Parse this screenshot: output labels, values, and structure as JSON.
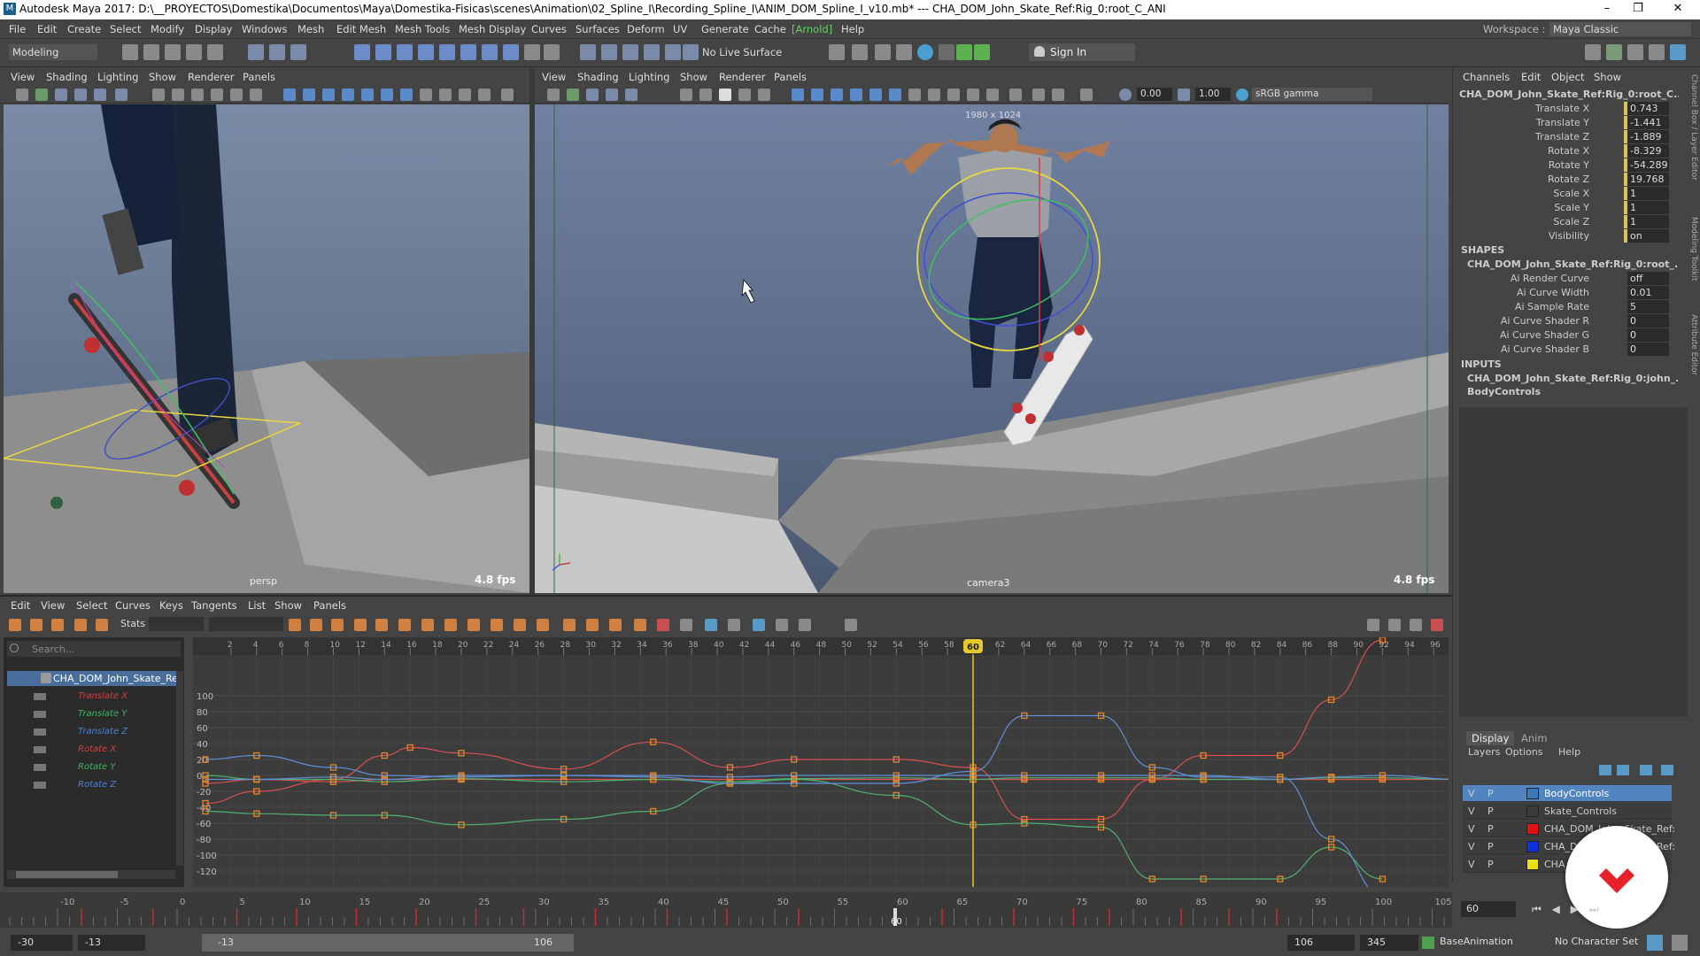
{
  "title_bar": {
    "logo": "M",
    "title": "Autodesk Maya 2017: D:\\__PROYECTOS\\Domestika\\Documentos\\Maya\\Domestika-Fisicas\\scenes\\Animation\\02_Spline_I\\Recording_Spline_I\\ANIM_DOM_Spline_I_v10.mb*   ---   CHA_DOM_John_Skate_Ref:Rig_0:root_C_ANI",
    "minimize": "–",
    "maximize": "❐",
    "close": "✕"
  },
  "menu": {
    "items": [
      "File",
      "Edit",
      "Create",
      "Select",
      "Modify",
      "Display",
      "Windows",
      "Mesh",
      "Edit Mesh",
      "Mesh Tools",
      "Mesh Display",
      "Curves",
      "Surfaces",
      "Deform",
      "UV",
      "Generate",
      "Cache",
      "[Arnold]",
      "Help"
    ],
    "workspace_label": "Workspace :",
    "workspace_value": "Maya Classic"
  },
  "toolbar": {
    "mode": "Modeling",
    "live_surface": "No Live Surface",
    "sign_in": "Sign In"
  },
  "viewport_left": {
    "menus": [
      "View",
      "Shading",
      "Lighting",
      "Show",
      "Renderer",
      "Panels"
    ],
    "camera": "persp",
    "fps": "4.8 fps"
  },
  "viewport_right": {
    "menus": [
      "View",
      "Shading",
      "Lighting",
      "Show",
      "Renderer",
      "Panels"
    ],
    "resolution": "1980 x 1024",
    "camera": "camera3",
    "fps": "4.8 fps",
    "exposure": "0.00",
    "gamma": "1.00",
    "color_space": "sRGB gamma"
  },
  "channel_box": {
    "tabs": [
      "Channels",
      "Edit",
      "Object",
      "Show"
    ],
    "object": "CHA_DOM_John_Skate_Ref:Rig_0:root_C...",
    "channels": [
      {
        "label": "Translate X",
        "value": "0.743"
      },
      {
        "label": "Translate Y",
        "value": "-1.441"
      },
      {
        "label": "Translate Z",
        "value": "-1.889"
      },
      {
        "label": "Rotate X",
        "value": "-8.329"
      },
      {
        "label": "Rotate Y",
        "value": "-54.289"
      },
      {
        "label": "Rotate Z",
        "value": "19.768"
      },
      {
        "label": "Scale X",
        "value": "1"
      },
      {
        "label": "Scale Y",
        "value": "1"
      },
      {
        "label": "Scale Z",
        "value": "1"
      },
      {
        "label": "Visibility",
        "value": "on"
      }
    ],
    "shapes_header": "SHAPES",
    "shape_name": "CHA_DOM_John_Skate_Ref:Rig_0:root_...",
    "shape_attrs": [
      {
        "label": "Ai Render Curve",
        "value": "off"
      },
      {
        "label": "Ai Curve Width",
        "value": "0.01"
      },
      {
        "label": "Ai Sample Rate",
        "value": "5"
      },
      {
        "label": "Ai Curve Shader R",
        "value": "0"
      },
      {
        "label": "Ai Curve Shader G",
        "value": "0"
      },
      {
        "label": "Ai Curve Shader B",
        "value": "0"
      }
    ],
    "inputs_header": "INPUTS",
    "inputs": [
      "CHA_DOM_John_Skate_Ref:Rig_0:john_...",
      "BodyControls"
    ],
    "side_tabs": [
      "Channel Box / Layer Editor",
      "Modeling Toolkit",
      "Attribute Editor"
    ]
  },
  "layer_editor": {
    "tabs": [
      "Display",
      "Anim"
    ],
    "menus": [
      "Layers",
      "Options",
      "Help"
    ],
    "layers": [
      {
        "v": "V",
        "p": "P",
        "name": "BodyControls",
        "color": "#3a78b8",
        "selected": true
      },
      {
        "v": "V",
        "p": "P",
        "name": "Skate_Controls",
        "color": "",
        "selected": false
      },
      {
        "v": "V",
        "p": "P",
        "name": "CHA_DOM_John_Skate_Ref:",
        "color": "#e01010",
        "selected": false
      },
      {
        "v": "V",
        "p": "P",
        "name": "CHA_DOM_John_Skate_Ref:",
        "color": "#1030e0",
        "selected": false
      },
      {
        "v": "V",
        "p": "P",
        "name": "CHA_D",
        "color": "#e8e010",
        "selected": false
      }
    ]
  },
  "graph_editor": {
    "menus": [
      "Edit",
      "View",
      "Select",
      "Curves",
      "Keys",
      "Tangents",
      "List",
      "Show",
      "Panels"
    ],
    "stats_label": "Stats",
    "search_placeholder": "Search...",
    "outliner_node": "CHA_DOM_John_Skate_Ref",
    "outliner_curves": [
      {
        "label": "Translate X",
        "color": "#d04040"
      },
      {
        "label": "Translate Y",
        "color": "#40b060"
      },
      {
        "label": "Translate Z",
        "color": "#5080d0"
      },
      {
        "label": "Rotate X",
        "color": "#d04040"
      },
      {
        "label": "Rotate Y",
        "color": "#40b060"
      },
      {
        "label": "Rotate Z",
        "color": "#5080d0"
      }
    ],
    "current_frame": "60",
    "frame_ticks": [
      "2",
      "4",
      "6",
      "8",
      "10",
      "12",
      "14",
      "16",
      "18",
      "20",
      "22",
      "24",
      "26",
      "28",
      "30",
      "32",
      "34",
      "36",
      "38",
      "40",
      "42",
      "44",
      "46",
      "48",
      "50",
      "52",
      "54",
      "56",
      "58",
      "60",
      "62",
      "64",
      "66",
      "68",
      "70",
      "72",
      "74",
      "76",
      "78",
      "80",
      "82",
      "84",
      "86",
      "88",
      "90",
      "92",
      "94",
      "96",
      "98"
    ],
    "value_ticks": [
      "100",
      "80",
      "60",
      "40",
      "20",
      "0",
      "-20",
      "-40",
      "-60",
      "-80",
      "-100",
      "-120"
    ]
  },
  "chart_data": {
    "type": "line",
    "title": "",
    "xlabel": "",
    "ylabel": "",
    "xlim": [
      0,
      98
    ],
    "ylim": [
      -130,
      115
    ],
    "series": [
      {
        "color": "#d85050",
        "points": [
          [
            0,
            -35
          ],
          [
            4,
            -20
          ],
          [
            10,
            -5
          ],
          [
            14,
            25
          ],
          [
            16,
            35
          ],
          [
            20,
            28
          ],
          [
            28,
            8
          ],
          [
            35,
            42
          ],
          [
            41,
            10
          ],
          [
            46,
            20
          ],
          [
            54,
            20
          ],
          [
            60,
            10
          ],
          [
            64,
            -55
          ],
          [
            70,
            -55
          ],
          [
            74,
            -5
          ],
          [
            78,
            25
          ],
          [
            84,
            25
          ],
          [
            88,
            95
          ],
          [
            92,
            170
          ]
        ]
      },
      {
        "color": "#d85050",
        "points": [
          [
            0,
            -10
          ],
          [
            4,
            -5
          ],
          [
            10,
            -8
          ],
          [
            14,
            -5
          ],
          [
            20,
            -5
          ],
          [
            28,
            -5
          ],
          [
            35,
            -5
          ],
          [
            41,
            -5
          ],
          [
            46,
            -5
          ],
          [
            54,
            -5
          ],
          [
            60,
            -5
          ],
          [
            64,
            -5
          ],
          [
            70,
            -5
          ],
          [
            74,
            -5
          ],
          [
            78,
            -5
          ],
          [
            84,
            -5
          ],
          [
            88,
            -5
          ],
          [
            92,
            -5
          ],
          [
            98,
            -5
          ]
        ]
      },
      {
        "color": "#50b070",
        "points": [
          [
            0,
            -45
          ],
          [
            4,
            -48
          ],
          [
            10,
            -50
          ],
          [
            14,
            -50
          ],
          [
            20,
            -62
          ],
          [
            28,
            -55
          ],
          [
            35,
            -45
          ],
          [
            41,
            -10
          ],
          [
            46,
            -5
          ],
          [
            54,
            -25
          ],
          [
            60,
            -62
          ],
          [
            64,
            -60
          ],
          [
            70,
            -65
          ],
          [
            74,
            -130
          ],
          [
            78,
            -130
          ],
          [
            84,
            -130
          ],
          [
            88,
            -90
          ],
          [
            92,
            -130
          ]
        ]
      },
      {
        "color": "#50b070",
        "points": [
          [
            0,
            0
          ],
          [
            4,
            -5
          ],
          [
            10,
            -5
          ],
          [
            14,
            -8
          ],
          [
            20,
            -4
          ],
          [
            28,
            -8
          ],
          [
            35,
            -5
          ],
          [
            41,
            -8
          ],
          [
            46,
            -4
          ],
          [
            54,
            -3
          ],
          [
            60,
            -5
          ],
          [
            64,
            -3
          ],
          [
            70,
            -3
          ],
          [
            74,
            -3
          ],
          [
            78,
            -5
          ],
          [
            84,
            -5
          ],
          [
            88,
            -3
          ],
          [
            92,
            -3
          ],
          [
            98,
            -5
          ]
        ]
      },
      {
        "color": "#6090d8",
        "points": [
          [
            0,
            20
          ],
          [
            4,
            25
          ],
          [
            10,
            10
          ],
          [
            14,
            0
          ],
          [
            20,
            -2
          ],
          [
            28,
            0
          ],
          [
            35,
            -2
          ],
          [
            41,
            -10
          ],
          [
            46,
            -10
          ],
          [
            54,
            -10
          ],
          [
            60,
            5
          ],
          [
            64,
            75
          ],
          [
            70,
            75
          ],
          [
            74,
            10
          ],
          [
            78,
            -2
          ],
          [
            84,
            -2
          ],
          [
            88,
            -80
          ],
          [
            92,
            -150
          ]
        ]
      },
      {
        "color": "#6090d8",
        "points": [
          [
            0,
            -5
          ],
          [
            4,
            -5
          ],
          [
            10,
            -2
          ],
          [
            14,
            -5
          ],
          [
            20,
            0
          ],
          [
            28,
            0
          ],
          [
            35,
            0
          ],
          [
            41,
            -2
          ],
          [
            46,
            0
          ],
          [
            54,
            0
          ],
          [
            60,
            0
          ],
          [
            64,
            0
          ],
          [
            70,
            0
          ],
          [
            74,
            0
          ],
          [
            78,
            0
          ],
          [
            84,
            -5
          ],
          [
            88,
            -2
          ],
          [
            92,
            0
          ],
          [
            98,
            -5
          ]
        ]
      }
    ]
  },
  "time_slider": {
    "labels": [
      "-10",
      "-5",
      "0",
      "5",
      "10",
      "15",
      "20",
      "25",
      "30",
      "35",
      "40",
      "45",
      "50",
      "55",
      "60",
      "65",
      "70",
      "75",
      "80",
      "85",
      "90",
      "95",
      "100",
      "105"
    ],
    "current": "60",
    "current_field": "60"
  },
  "range_slider": {
    "start": "-30",
    "start_inner": "-13",
    "range_start": "-13",
    "range_end": "106",
    "end_inner": "106",
    "end": "345",
    "anim_layer": "BaseAnimation",
    "char_set": "No Character Set"
  }
}
